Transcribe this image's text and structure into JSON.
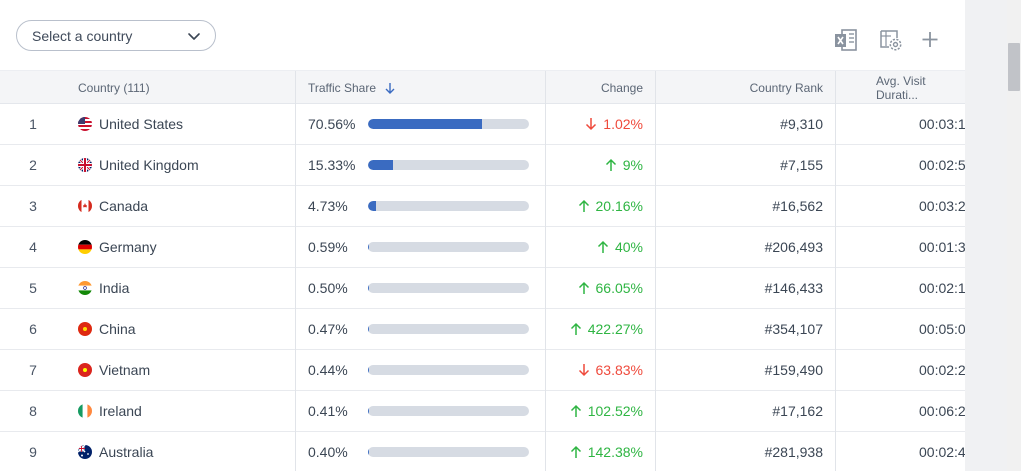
{
  "select": {
    "label": "Select a country"
  },
  "table": {
    "headers": {
      "country": "Country (111)",
      "traffic_share": "Traffic Share",
      "change": "Change",
      "country_rank": "Country Rank",
      "avg_visit": "Avg. Visit Durati..."
    },
    "rows": [
      {
        "idx": "1",
        "country": "United States",
        "share": "70.56%",
        "share_value": 70.56,
        "change": "1.02%",
        "direction": "down",
        "rank": "#9,310",
        "duration": "00:03:1"
      },
      {
        "idx": "2",
        "country": "United Kingdom",
        "share": "15.33%",
        "share_value": 15.33,
        "change": "9%",
        "direction": "up",
        "rank": "#7,155",
        "duration": "00:02:5"
      },
      {
        "idx": "3",
        "country": "Canada",
        "share": "4.73%",
        "share_value": 4.73,
        "change": "20.16%",
        "direction": "up",
        "rank": "#16,562",
        "duration": "00:03:2"
      },
      {
        "idx": "4",
        "country": "Germany",
        "share": "0.59%",
        "share_value": 0.59,
        "change": "40%",
        "direction": "up",
        "rank": "#206,493",
        "duration": "00:01:3"
      },
      {
        "idx": "5",
        "country": "India",
        "share": "0.50%",
        "share_value": 0.5,
        "change": "66.05%",
        "direction": "up",
        "rank": "#146,433",
        "duration": "00:02:1"
      },
      {
        "idx": "6",
        "country": "China",
        "share": "0.47%",
        "share_value": 0.47,
        "change": "422.27%",
        "direction": "up",
        "rank": "#354,107",
        "duration": "00:05:0"
      },
      {
        "idx": "7",
        "country": "Vietnam",
        "share": "0.44%",
        "share_value": 0.44,
        "change": "63.83%",
        "direction": "down",
        "rank": "#159,490",
        "duration": "00:02:2"
      },
      {
        "idx": "8",
        "country": "Ireland",
        "share": "0.41%",
        "share_value": 0.41,
        "change": "102.52%",
        "direction": "up",
        "rank": "#17,162",
        "duration": "00:06:2"
      },
      {
        "idx": "9",
        "country": "Australia",
        "share": "0.40%",
        "share_value": 0.4,
        "change": "142.38%",
        "direction": "up",
        "rank": "#281,938",
        "duration": "00:02:4"
      }
    ]
  },
  "colors": {
    "bar_fill": "#3a6bc1",
    "bar_track": "#d6dbe3",
    "up": "#2fb543",
    "down": "#ef4a3c"
  },
  "icons": [
    "excel-icon",
    "table-settings-icon",
    "add-icon",
    "chevron-down-icon",
    "sort-down-icon",
    "arrow-up-icon",
    "arrow-down-icon"
  ]
}
